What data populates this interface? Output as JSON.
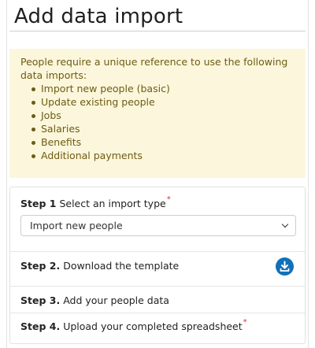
{
  "header": {
    "title": "Add data import"
  },
  "info": {
    "text": "People require a unique reference to use the following data imports:",
    "items": [
      "Import new people (basic)",
      "Update existing people",
      "Jobs",
      "Salaries",
      "Benefits",
      "Additional payments"
    ],
    "colors": {
      "background": "#fcf7dc",
      "text": "#6d5b14"
    }
  },
  "steps": {
    "step1": {
      "number": "Step 1",
      "label": "Select an import type",
      "required_mark": "*",
      "select_value": "Import new people"
    },
    "step2": {
      "number": "Step 2.",
      "label": "Download the template",
      "icon": "download-icon"
    },
    "step3": {
      "number": "Step 3.",
      "label": "Add your people data"
    },
    "step4": {
      "number": "Step 4.",
      "label": "Upload your completed spreadsheet",
      "required_mark": "*"
    }
  },
  "colors": {
    "accent": "#1170b8",
    "required": "#d0332f"
  }
}
